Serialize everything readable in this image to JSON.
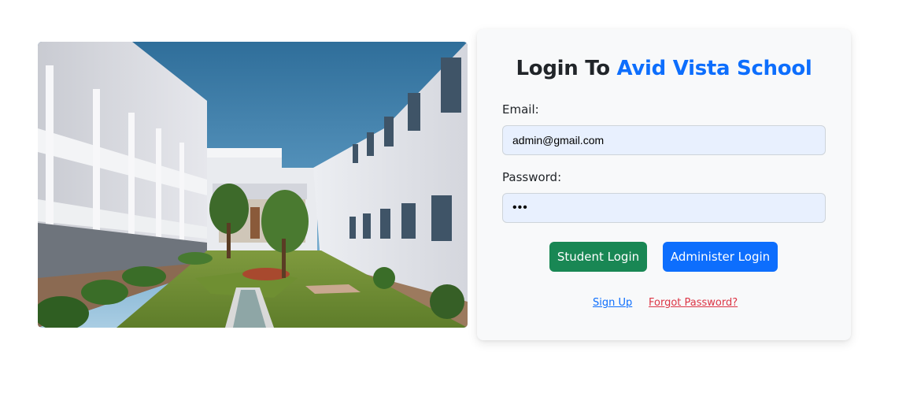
{
  "login": {
    "title_prefix": "Login To ",
    "title_brand": "Avid Vista School",
    "email_label": "Email:",
    "email_value": "admin@gmail.com",
    "password_label": "Password:",
    "password_value": "•••",
    "student_login_label": "Student Login",
    "admin_login_label": "Administer Login",
    "signup_link": "Sign Up",
    "forgot_link": "Forgot Password?"
  },
  "colors": {
    "brand_blue": "#0d6efd",
    "student_green": "#198754",
    "forgot_red": "#dc3545",
    "card_bg": "#f8f9fa",
    "input_bg": "#e8f0fe"
  }
}
